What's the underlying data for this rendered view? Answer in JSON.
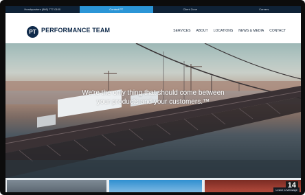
{
  "utility_bar": {
    "items": [
      {
        "label": "Headquarters (866) 777-0100",
        "active": false
      },
      {
        "label": "Contact PT",
        "active": true
      },
      {
        "label": "Client Zone",
        "active": false
      },
      {
        "label": "Careers",
        "active": false
      }
    ]
  },
  "header": {
    "logo_text": "PT",
    "brand_name": "PERFORMANCE TEAM",
    "nav": [
      "SERVICES",
      "ABOUT",
      "LOCATIONS",
      "NEWS & MEDIA",
      "CONTACT"
    ]
  },
  "hero": {
    "line1": "We're the only thing that should come between",
    "line2": "your products and your customers.™"
  },
  "strip": {
    "number_sign": "14",
    "chat_label": "Leave a Message"
  },
  "colors": {
    "navy": "#0f2a4a",
    "accent_blue": "#2b95d6",
    "utility_bar": "#0f2236"
  }
}
